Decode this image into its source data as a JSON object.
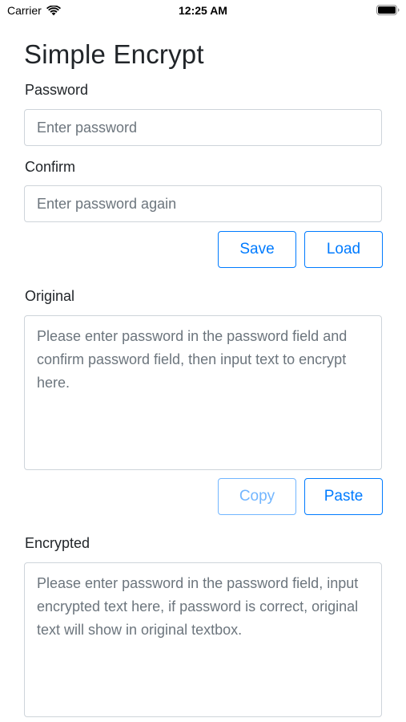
{
  "status_bar": {
    "carrier": "Carrier",
    "time": "12:25 AM",
    "icons": [
      "wifi-icon",
      "battery-icon"
    ]
  },
  "page": {
    "title": "Simple Encrypt"
  },
  "password": {
    "label": "Password",
    "value": "",
    "placeholder": "Enter password"
  },
  "confirm": {
    "label": "Confirm",
    "value": "",
    "placeholder": "Enter password again"
  },
  "password_actions": {
    "save_label": "Save",
    "load_label": "Load"
  },
  "original": {
    "label": "Original",
    "value": "",
    "placeholder": "Please enter password in the password field and confirm password field, then input text to encrypt here."
  },
  "original_actions": {
    "copy_label": "Copy",
    "copy_disabled": true,
    "paste_label": "Paste"
  },
  "encrypted": {
    "label": "Encrypted",
    "value": "",
    "placeholder": "Please enter password in the password field, input encrypted text here, if password is correct, original text will show in original textbox."
  },
  "colors": {
    "accent": "#007bff",
    "text": "#212529",
    "placeholder": "#6c757d",
    "border": "#ced4da"
  }
}
